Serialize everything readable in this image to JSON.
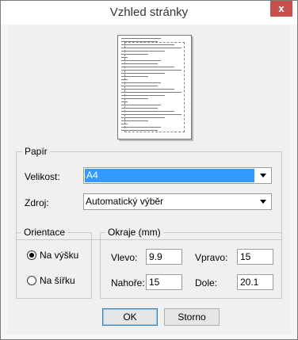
{
  "window": {
    "title": "Vzhled stránky",
    "close_glyph": "x",
    "close_icon": "close-icon"
  },
  "preview": {
    "icon": "page-preview-icon"
  },
  "paper": {
    "group_label": "Papír",
    "size_label": "Velikost:",
    "size_value": "A4",
    "source_label": "Zdroj:",
    "source_value": "Automatický výběr"
  },
  "orientation": {
    "group_label": "Orientace",
    "portrait_label": "Na výšku",
    "landscape_label": "Na šířku",
    "selected": "portrait"
  },
  "margins": {
    "group_label": "Okraje (mm)",
    "left_label": "Vlevo:",
    "left_value": "9.9",
    "right_label": "Vpravo:",
    "right_value": "15",
    "top_label": "Nahoře:",
    "top_value": "15",
    "bottom_label": "Dole:",
    "bottom_value": "20.1"
  },
  "buttons": {
    "ok": "OK",
    "cancel": "Storno"
  },
  "colors": {
    "selection": "#3399ff",
    "close_button": "#c7504c"
  }
}
